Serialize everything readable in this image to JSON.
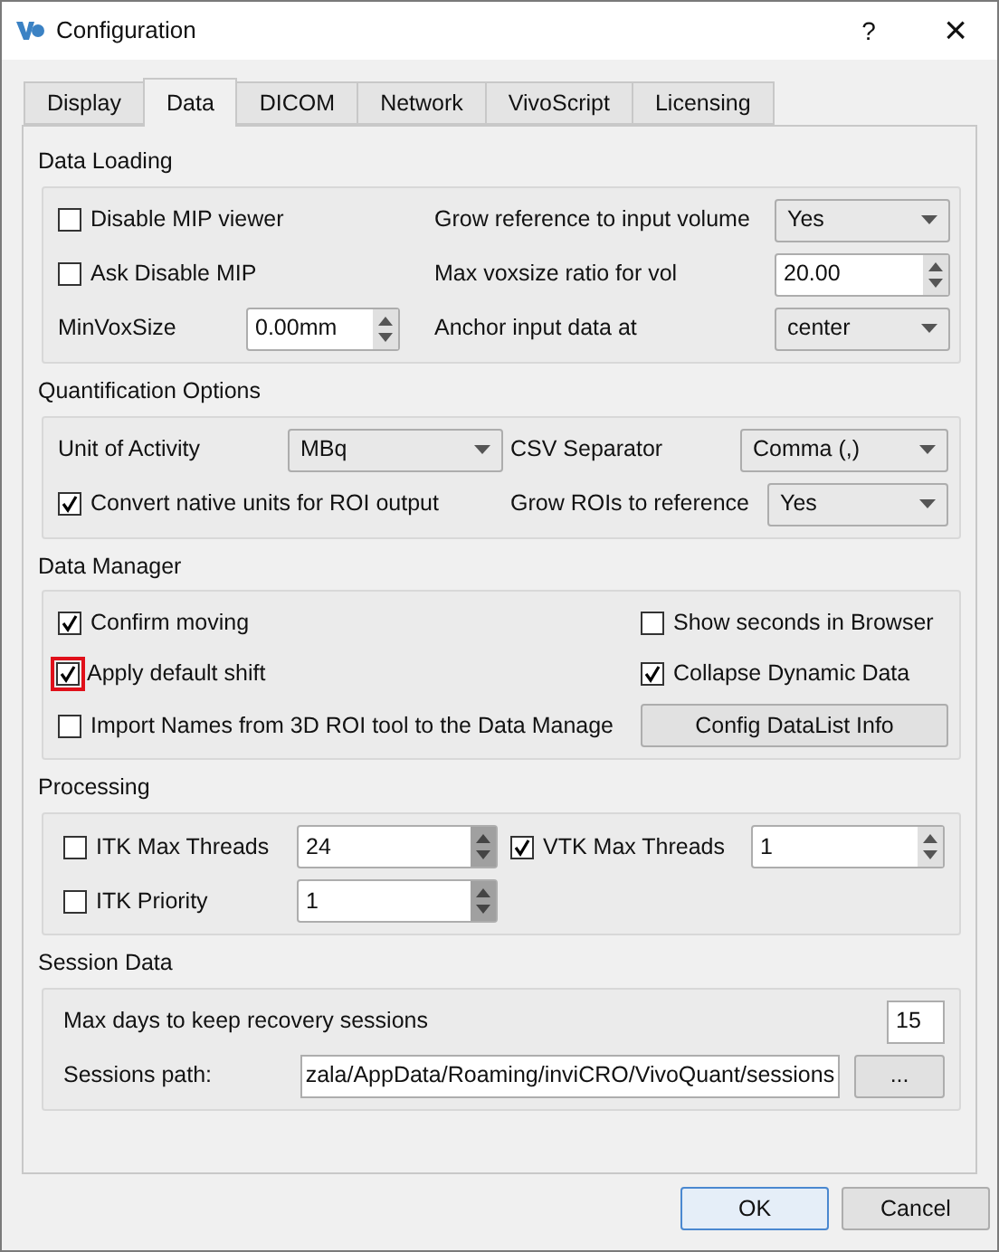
{
  "window": {
    "title": "Configuration",
    "help": "?",
    "close": "×"
  },
  "tabs": [
    {
      "label": "Display",
      "selected": false
    },
    {
      "label": "Data",
      "selected": true
    },
    {
      "label": "DICOM",
      "selected": false
    },
    {
      "label": "Network",
      "selected": false
    },
    {
      "label": "VivoScript",
      "selected": false
    },
    {
      "label": "Licensing",
      "selected": false
    }
  ],
  "data_loading": {
    "title": "Data Loading",
    "disable_mip_viewer": {
      "label": "Disable MIP viewer",
      "checked": false
    },
    "ask_disable_mip": {
      "label": "Ask Disable MIP",
      "checked": false
    },
    "min_vox_size": {
      "label": "MinVoxSize",
      "value": "0.00mm"
    },
    "grow_reference": {
      "label": "Grow reference to input volume",
      "value": "Yes"
    },
    "max_voxsize_ratio": {
      "label": "Max voxsize ratio for vol",
      "value": "20.00"
    },
    "anchor": {
      "label": "Anchor input data at",
      "value": "center"
    }
  },
  "quantification": {
    "title": "Quantification Options",
    "unit_of_activity": {
      "label": "Unit of Activity",
      "value": "MBq"
    },
    "csv_separator": {
      "label": "CSV Separator",
      "value": "Comma (,)"
    },
    "convert_units": {
      "label": "Convert native units for ROI output",
      "checked": true
    },
    "grow_rois": {
      "label": "Grow ROIs to reference",
      "value": "Yes"
    }
  },
  "data_manager": {
    "title": "Data Manager",
    "confirm_moving": {
      "label": "Confirm moving",
      "checked": true
    },
    "show_seconds": {
      "label": "Show seconds in Browser",
      "checked": false
    },
    "apply_default_shift": {
      "label": "Apply default shift",
      "checked": true,
      "highlighted": true
    },
    "collapse_dynamic": {
      "label": "Collapse Dynamic Data",
      "checked": true
    },
    "import_names": {
      "label": "Import Names from 3D ROI tool to the Data Manage",
      "checked": false
    },
    "config_button": "Config DataList Info"
  },
  "processing": {
    "title": "Processing",
    "itk_max_threads": {
      "label": "ITK Max Threads",
      "checked": false,
      "value": "24"
    },
    "vtk_max_threads": {
      "label": "VTK Max Threads",
      "checked": true,
      "value": "1"
    },
    "itk_priority": {
      "label": "ITK Priority",
      "checked": false,
      "value": "1"
    }
  },
  "session": {
    "title": "Session Data",
    "max_days": {
      "label": "Max days to keep recovery sessions",
      "value": "15"
    },
    "path": {
      "label": "Sessions path:",
      "value": "zala/AppData/Roaming/inviCRO/VivoQuant/sessions",
      "browse": "..."
    }
  },
  "buttons": [
    {
      "label": "OK",
      "default": true
    },
    {
      "label": "Cancel",
      "default": false
    }
  ]
}
